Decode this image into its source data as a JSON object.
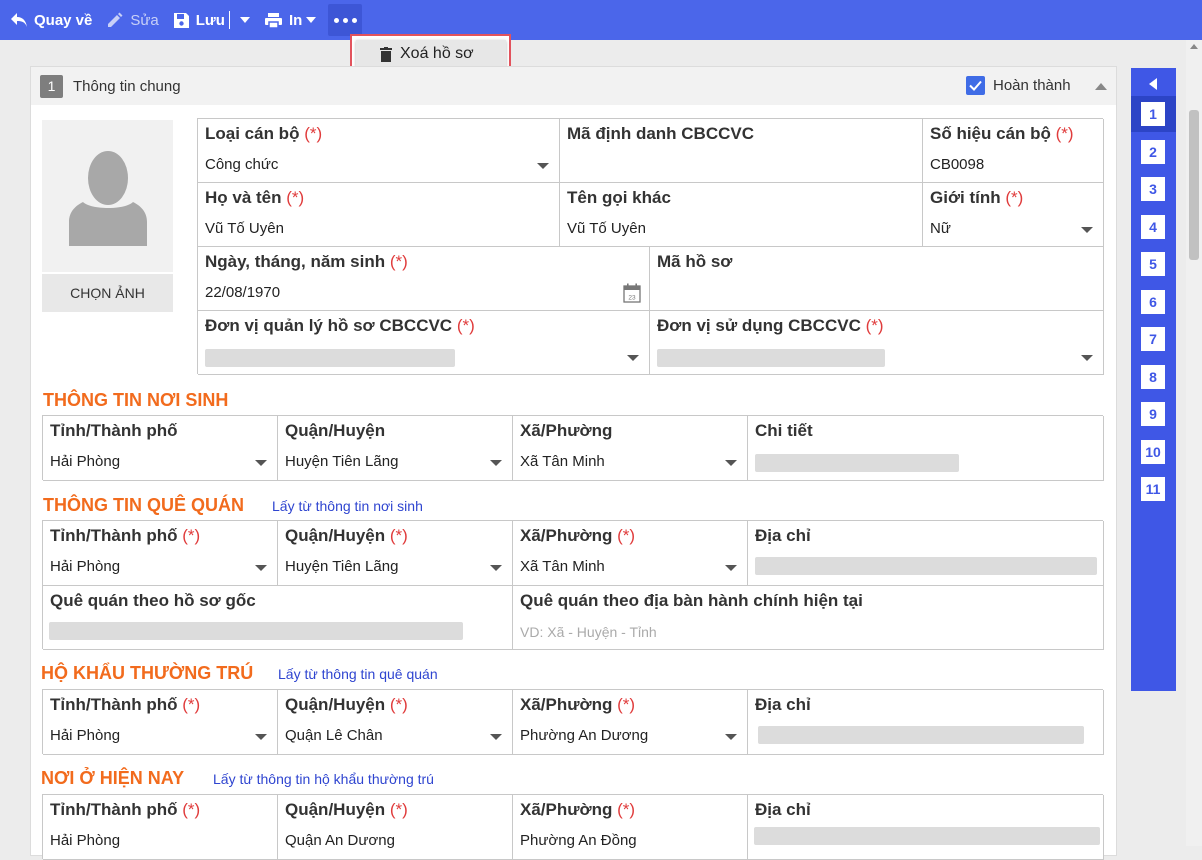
{
  "toolbar": {
    "back_label": "Quay về",
    "edit_label": "Sửa",
    "save_label": "Lưu",
    "print_label": "In"
  },
  "dropdown": {
    "delete_label": "Xoá hồ sơ"
  },
  "section": {
    "number": "1",
    "title": "Thông tin chung",
    "done_label": "Hoàn thành"
  },
  "photo": {
    "choose_label": "CHỌN ẢNH"
  },
  "required_mark": "(*)",
  "general": {
    "loai_can_bo": {
      "label": "Loại cán bộ",
      "value": "Công chức"
    },
    "ma_dinh_danh": {
      "label": "Mã định danh CBCCVC",
      "value": ""
    },
    "so_hieu": {
      "label": "Số hiệu cán bộ",
      "value": "CB0098"
    },
    "ho_ten": {
      "label": "Họ và tên",
      "value": "Vũ Tố Uyên"
    },
    "ten_goi_khac": {
      "label": "Tên gọi khác",
      "value": "Vũ Tố Uyên"
    },
    "gioi_tinh": {
      "label": "Giới tính",
      "value": "Nữ"
    },
    "ngay_sinh": {
      "label": "Ngày, tháng, năm sinh",
      "value": "22/08/1970",
      "calendar_day": "23"
    },
    "ma_ho_so": {
      "label": "Mã hồ sơ",
      "value": ""
    },
    "don_vi_quan_ly": {
      "label": "Đơn vị quản lý hồ sơ CBCCVC"
    },
    "don_vi_su_dung": {
      "label": "Đơn vị sử dụng CBCCVC"
    }
  },
  "noi_sinh": {
    "heading": "THÔNG TIN NƠI SINH",
    "tinh": {
      "label": "Tỉnh/Thành phố",
      "value": "Hải Phòng"
    },
    "huyen": {
      "label": "Quận/Huyện",
      "value": "Huyện Tiên Lãng"
    },
    "xa": {
      "label": "Xã/Phường",
      "value": "Xã Tân Minh"
    },
    "chi_tiet": {
      "label": "Chi tiết"
    }
  },
  "que_quan": {
    "heading": "THÔNG TIN QUÊ QUÁN",
    "link": "Lấy từ thông tin nơi sinh",
    "tinh": {
      "label": "Tỉnh/Thành phố",
      "value": "Hải Phòng"
    },
    "huyen": {
      "label": "Quận/Huyện",
      "value": "Huyện Tiên Lãng"
    },
    "xa": {
      "label": "Xã/Phường",
      "value": "Xã Tân Minh"
    },
    "dia_chi": {
      "label": "Địa chỉ"
    },
    "goc": {
      "label": "Quê quán theo hồ sơ gốc"
    },
    "hien_tai": {
      "label": "Quê quán theo địa bàn hành chính hiện tại",
      "placeholder": "VD: Xã - Huyện - Tỉnh"
    }
  },
  "ho_khau": {
    "heading": "HỘ KHẨU THƯỜNG TRÚ",
    "link": "Lấy từ thông tin quê quán",
    "tinh": {
      "label": "Tỉnh/Thành phố",
      "value": "Hải Phòng"
    },
    "huyen": {
      "label": "Quận/Huyện",
      "value": "Quận Lê Chân"
    },
    "xa": {
      "label": "Xã/Phường",
      "value": "Phường An Dương"
    },
    "dia_chi": {
      "label": "Địa chỉ"
    }
  },
  "noi_o": {
    "heading": "NƠI Ở HIỆN NAY",
    "link": "Lấy từ thông tin hộ khẩu thường trú",
    "tinh": {
      "label": "Tỉnh/Thành phố",
      "value": "Hải Phòng"
    },
    "huyen": {
      "label": "Quận/Huyện",
      "value": "Quận An Dương"
    },
    "xa": {
      "label": "Xã/Phường",
      "value": "Phường An Đồng"
    },
    "dia_chi": {
      "label": "Địa chỉ"
    }
  },
  "rail": {
    "items": [
      "1",
      "2",
      "3",
      "4",
      "5",
      "6",
      "7",
      "8",
      "9",
      "10",
      "11"
    ],
    "active": "1"
  }
}
